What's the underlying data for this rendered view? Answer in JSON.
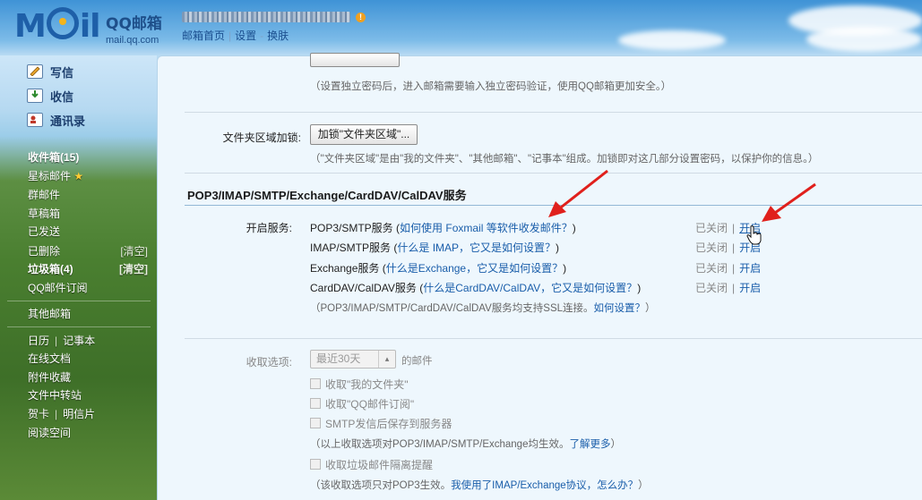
{
  "header": {
    "logo_text_left": "M",
    "logo_text_right": "il",
    "brand_title": "QQ邮箱",
    "brand_domain": "mail.qq.com",
    "links": [
      "邮箱首页",
      "设置",
      "换肤"
    ]
  },
  "sidebar": {
    "compose": [
      {
        "label": "写信",
        "icon": "pencil-icon"
      },
      {
        "label": "收信",
        "icon": "inbox-download-icon"
      },
      {
        "label": "通讯录",
        "icon": "contacts-icon"
      }
    ],
    "folders": [
      {
        "label": "收件箱(15)",
        "bold": true
      },
      {
        "label": "星标邮件",
        "star": "★"
      },
      {
        "label": "群邮件"
      },
      {
        "label": "草稿箱"
      },
      {
        "label": "已发送"
      },
      {
        "label": "已删除",
        "action": "[清空]"
      },
      {
        "label": "垃圾箱(4)",
        "bold": true,
        "action": "[清空]"
      },
      {
        "label": "QQ邮件订阅"
      }
    ],
    "other_mailbox": "其他邮箱",
    "tools": {
      "calendar": "日历",
      "notepad": "记事本",
      "online_docs": "在线文档",
      "attachments": "附件收藏",
      "file_transfer": "文件中转站",
      "greeting": "贺卡",
      "postcard": "明信片",
      "reading": "阅读空间"
    }
  },
  "main": {
    "password_note": "（设置独立密码后，进入邮箱需要输入独立密码验证，使用QQ邮箱更加安全。）",
    "folder_lock_label": "文件夹区域加锁:",
    "folder_lock_button": "加锁\"文件夹区域\"...",
    "folder_lock_note": "（\"文件夹区域\"是由\"我的文件夹\"、\"其他邮箱\"、\"记事本\"组成。加锁即对这几部分设置密码，以保护你的信息。）",
    "section_title": "POP3/IMAP/SMTP/Exchange/CardDAV/CalDAV服务",
    "enable_label": "开启服务:",
    "services": [
      {
        "name": "POP3/SMTP服务",
        "help": "如何使用 Foxmail 等软件收发邮件？",
        "status": "已关闭",
        "action": "开启"
      },
      {
        "name": "IMAP/SMTP服务",
        "help": "什么是 IMAP，它又是如何设置？",
        "status": "已关闭",
        "action": "开启"
      },
      {
        "name": "Exchange服务",
        "help": "什么是Exchange，它又是如何设置？",
        "status": "已关闭",
        "action": "开启"
      },
      {
        "name": "CardDAV/CalDAV服务",
        "help": "什么是CardDAV/CalDAV，它又是如何设置？",
        "status": "已关闭",
        "action": "开启"
      }
    ],
    "ssl_note_prefix": "（POP3/IMAP/SMTP/CardDAV/CalDAV服务均支持SSL连接。",
    "ssl_note_link": "如何设置？",
    "ssl_note_suffix": "）",
    "receive_label": "收取选项:",
    "receive_select": "最近30天",
    "receive_suffix": "的邮件",
    "checkboxes": [
      "收取\"我的文件夹\"",
      "收取\"QQ邮件订阅\"",
      "SMTP发信后保存到服务器"
    ],
    "receive_note_prefix": "（以上收取选项对POP3/IMAP/SMTP/Exchange均生效。",
    "receive_note_link": "了解更多",
    "receive_note_suffix": "）",
    "spam_checkbox": "收取垃圾邮件隔离提醒",
    "pop3_note_prefix": "（该收取选项只对POP3生效。",
    "pop3_note_link": "我使用了IMAP/Exchange协议，怎么办？",
    "pop3_note_suffix": "）"
  },
  "colors": {
    "link": "#1a5eaa",
    "annotation_arrow": "#e0201c"
  }
}
